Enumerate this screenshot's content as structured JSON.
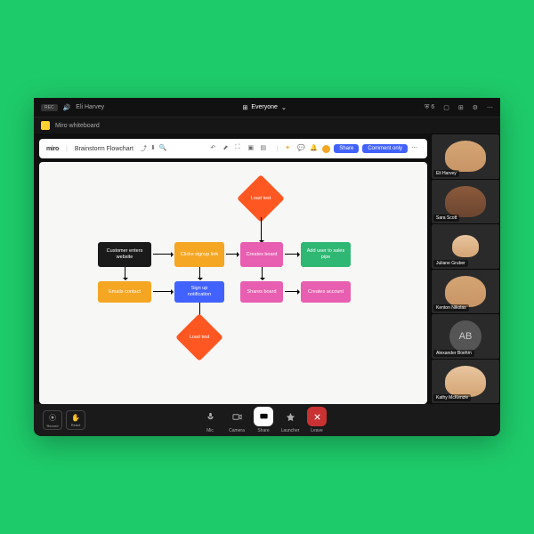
{
  "topbar": {
    "rec": "REC",
    "presenter": "Eli Harvey",
    "center": "Everyone",
    "people_count": "6"
  },
  "tab": {
    "name": "Miro whiteboard"
  },
  "miro": {
    "brand": "miro",
    "title": "Brainstorm Flowchart",
    "share": "Share",
    "comment": "Comment only"
  },
  "flowchart": {
    "load_test_top": "Load test",
    "customer_enters": "Customer\nenters website",
    "clicks_signup": "Clicks signup\nlink",
    "creates_board": "Creates\nboard",
    "add_user": "Add user to\nsales pipe",
    "emails_contact": "Emails contact",
    "signup_notif": "Sign up\nnotification",
    "shares_board": "Shares\nboard",
    "creates_account": "Creates\naccount",
    "load_test_bot": "Load test"
  },
  "participants": [
    {
      "name": "Eli Harvey",
      "initials": null
    },
    {
      "name": "Sara Scott",
      "initials": null
    },
    {
      "name": "Juliane Gruber",
      "initials": null
    },
    {
      "name": "Kenton Nikolas",
      "initials": null
    },
    {
      "name": "Alexander Boehm",
      "initials": "AB"
    },
    {
      "name": "Kathy McKenzie",
      "initials": null
    }
  ],
  "dock": {
    "record": "Record",
    "react": "React",
    "mic": "Mic",
    "camera": "Camera",
    "share": "Share",
    "launcher": "Launcher",
    "leave": "Leave"
  }
}
